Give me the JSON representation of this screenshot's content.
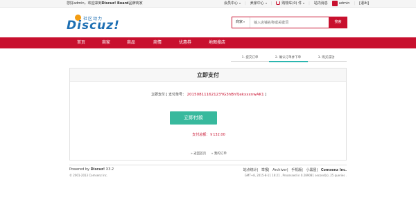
{
  "topbar": {
    "welcome_prefix": "您好admin，欢迎来到",
    "welcome_brand": "Discuz! Board",
    "welcome_suffix": "品牌商家",
    "member_center": "会员中心",
    "seller_center": "卖家中心",
    "cart": "购物车(0) 件",
    "site_nav": "站内消息",
    "username": "admin",
    "logout": "[退出]"
  },
  "logo": {
    "text": "Discuz!",
    "tagline": "社区动力"
  },
  "search": {
    "category": "商家",
    "placeholder": "输入店铺名称或关键词",
    "button": "搜索"
  },
  "nav": {
    "items": [
      "首页",
      "商家",
      "商品",
      "商情",
      "优惠券",
      "地图搜店"
    ]
  },
  "steps": {
    "items": [
      "1. 提交订单",
      "2. 确认订单并下单",
      "3. 购买成功"
    ],
    "active_index": 1
  },
  "panel": {
    "title": "立即支付",
    "order_label": "立即支付 [ 支付单号：",
    "order_number": "20150811162123YG3hBhTJekxxxnwAK1",
    "order_close": "]",
    "pay_button": "立即付款",
    "total_label": "支付总额：￥132.00",
    "back_home": "返回首页",
    "my_orders": "我的订单"
  },
  "footer": {
    "powered_prefix": "Powered by",
    "powered_brand": "Discuz!",
    "powered_version": "X3.2",
    "copyright": "© 2001-2013 Comsenz Inc.",
    "links": [
      "站点统计",
      "举报",
      "Archiver",
      "手机版",
      "小黑屋",
      "Comsenz Inc."
    ],
    "gmt": "GMT+8, 2015-8-11 16:21 , Processed in 0.289081 second(s), 25 queries ."
  },
  "colors": {
    "brand_red": "#c8102e",
    "pay_green": "#38b99d",
    "step_teal": "#2cb6b0"
  }
}
